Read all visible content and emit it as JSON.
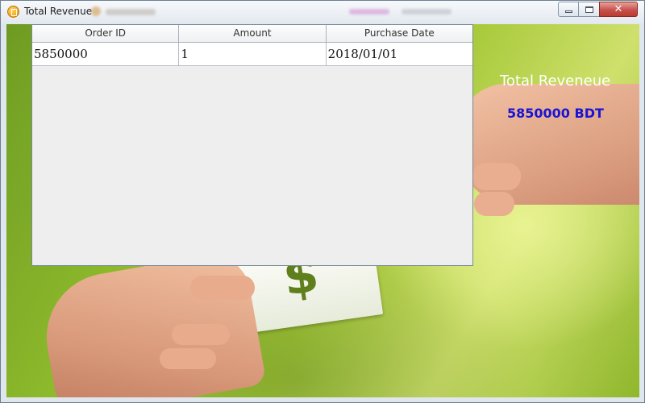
{
  "window": {
    "title": "Total Revenue",
    "buttons": {
      "minimize_icon": "minimize-icon",
      "maximize_icon": "maximize-icon",
      "close_icon": "close-icon",
      "close_glyph": "✕"
    }
  },
  "table": {
    "headers": [
      "Order ID",
      "Amount",
      "Purchase Date"
    ],
    "rows": [
      [
        "5850000",
        "1",
        "2018/01/01"
      ]
    ]
  },
  "summary": {
    "label": "Total Reveneue",
    "value": "5850000 BDT"
  },
  "colors": {
    "summary_value": "#1a14d4",
    "summary_label": "#ffffff",
    "close_button": "#c75050"
  },
  "background": {
    "image_subject": "hands-exchanging-money-icon",
    "banknote_symbol": "$"
  }
}
